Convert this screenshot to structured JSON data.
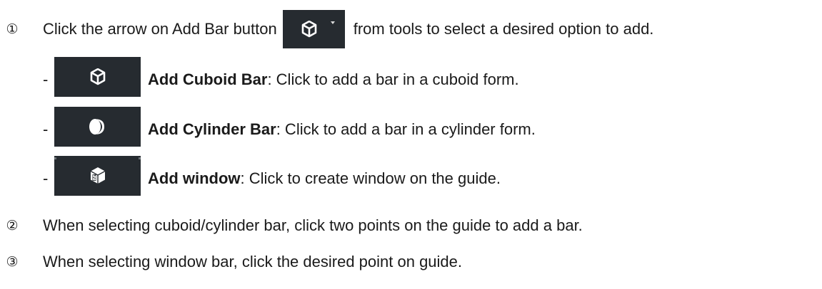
{
  "steps": [
    {
      "number": "①",
      "text_before": "Click the arrow on Add Bar button",
      "icon": "cuboid-dropdown-icon",
      "text_after": "from tools to select a desired option to add."
    },
    {
      "number": "②",
      "text": "When selecting cuboid/cylinder bar, click two points on the guide to add a bar."
    },
    {
      "number": "③",
      "text": "When selecting window bar, click the desired point on guide."
    }
  ],
  "options": [
    {
      "dash": "-",
      "icon": "cuboid-icon",
      "title": "Add Cuboid Bar",
      "description": ": Click to add a bar in a cuboid form."
    },
    {
      "dash": "-",
      "icon": "cylinder-icon",
      "title": "Add Cylinder Bar",
      "description": ": Click to add a bar in a cylinder form."
    },
    {
      "dash": "-",
      "icon": "window-cube-icon",
      "title": "Add window",
      "description": ": Click to create window on the guide."
    }
  ],
  "colors": {
    "tool_background": "#262b30",
    "icon_foreground": "#ffffff",
    "text": "#1a1a1a"
  }
}
